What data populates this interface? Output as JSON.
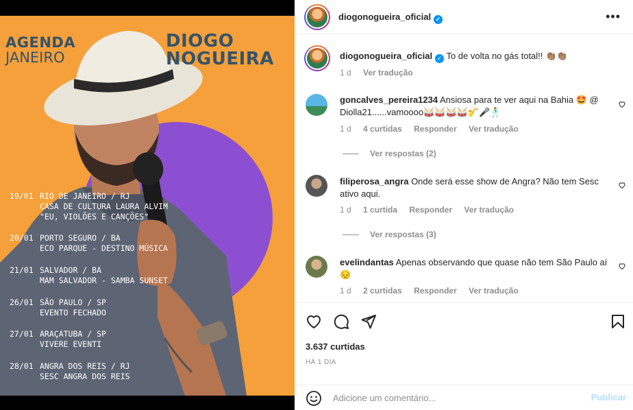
{
  "post": {
    "poster": {
      "title_line1": "AGENDA",
      "title_line2": "JANEIRO",
      "artist_line1": "DIOGO",
      "artist_line2": "NOGUEIRA",
      "events": [
        {
          "date": "19/01",
          "lines": [
            "RIO DE JANEIRO / RJ",
            "CASA DE CULTURA LAURA ALVIM",
            "\"EU, VIOLÕES E CANÇÕES\""
          ]
        },
        {
          "date": "20/01",
          "lines": [
            "PORTO SEGURO / BA",
            "ECO PARQUE - DESTINO MÚSICA"
          ]
        },
        {
          "date": "21/01",
          "lines": [
            "SALVADOR / BA",
            "MAM SALVADOR - SAMBA SUNSET"
          ]
        },
        {
          "date": "26/01",
          "lines": [
            "SÃO PAULO / SP",
            "EVENTO FECHADO"
          ]
        },
        {
          "date": "27/01",
          "lines": [
            "ARAÇATUBA / SP",
            "VIVERE EVENTI"
          ]
        },
        {
          "date": "28/01",
          "lines": [
            "ANGRA DOS REIS / RJ",
            "SESC ANGRA DOS REIS"
          ]
        }
      ],
      "colors": {
        "background": "#f6a03b",
        "circle": "#8d4fd1",
        "title": "#35546a"
      }
    }
  },
  "header": {
    "username": "diogonogueira_oficial",
    "more_icon": "more-horizontal-icon"
  },
  "caption": {
    "username": "diogonogueira_oficial",
    "text": "To de volta no gás total!! 👏🏽👏🏽",
    "time": "1 d",
    "translate": "Ver tradução"
  },
  "comments": [
    {
      "username": "goncalves_pereira1234",
      "text": "Ansiosa para te ver aqui na Bahia 🤩 @ Diolla21......vamoooo🥁🥁🥁🥁🎷🎤🕺",
      "time": "1 d",
      "likes": "4 curtidas",
      "reply": "Responder",
      "translate": "Ver tradução",
      "view_replies": "Ver respostas (2)"
    },
    {
      "username": "filiperosa_angra",
      "text": "Onde será esse show de Angra? Não tem Sesc ativo aqui.",
      "time": "1 d",
      "likes": "1 curtida",
      "reply": "Responder",
      "translate": "Ver tradução",
      "view_replies": "Ver respostas (3)"
    },
    {
      "username": "evelindantas",
      "text": "Apenas observando que quase não tem São Paulo aí 😔",
      "time": "1 d",
      "likes": "2 curtidas",
      "reply": "Responder",
      "translate": "Ver tradução"
    }
  ],
  "actions": {
    "icons": [
      "heart-icon",
      "comment-icon",
      "share-icon",
      "bookmark-icon"
    ],
    "likes": "3.637 curtidas",
    "time_ago": "HÁ 1 DIA"
  },
  "add_comment": {
    "placeholder": "Adicione um comentário...",
    "publish": "Publicar"
  }
}
